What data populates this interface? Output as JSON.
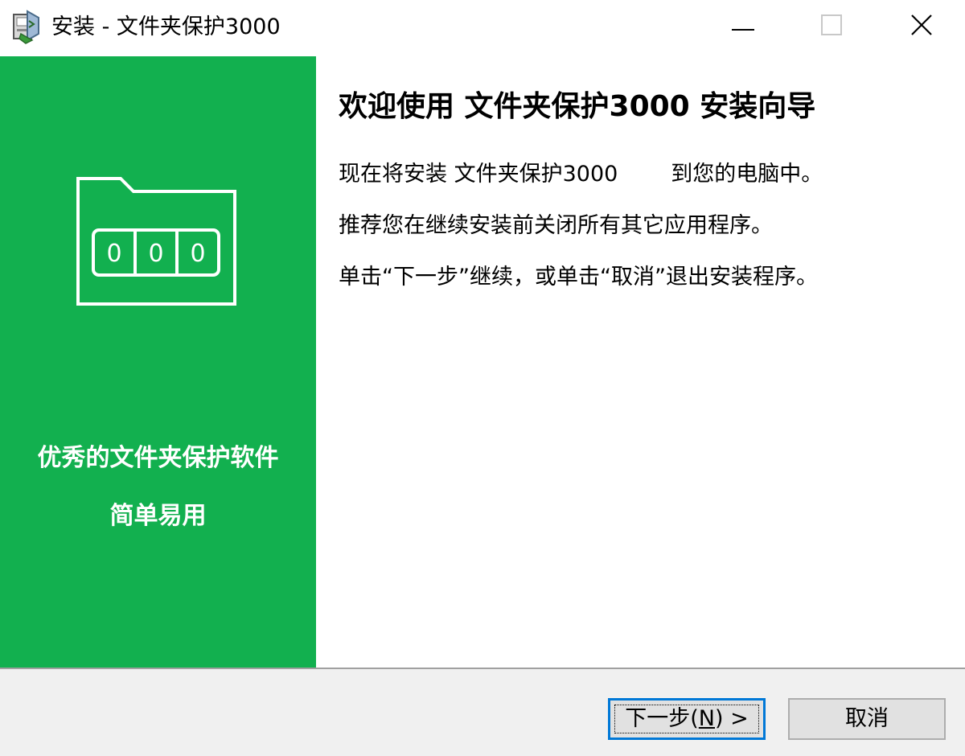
{
  "window": {
    "title": "安装 - 文件夹保护3000",
    "app_icon": "installer-icon",
    "controls": {
      "minimize": "minimize-icon",
      "maximize": "maximize-icon",
      "close": "close-icon"
    }
  },
  "side_panel": {
    "bg_color": "#12b04f",
    "graphic": {
      "icon": "folder-lock-icon",
      "digits": [
        "0",
        "0",
        "0"
      ]
    },
    "line1": "优秀的文件夹保护软件",
    "line2": "简单易用"
  },
  "main": {
    "heading": "欢迎使用 文件夹保护3000 安装向导",
    "para1_a": "现在将安装 文件夹保护3000",
    "para1_b": "到您的电脑中。",
    "para2": "推荐您在继续安装前关闭所有其它应用程序。",
    "para3": "单击“下一步”继续，或单击“取消”退出安装程序。"
  },
  "buttons": {
    "next_pre": "下一步(",
    "next_key": "N",
    "next_post": ") >",
    "cancel": "取消"
  },
  "colors": {
    "accent": "#0078d7",
    "green": "#12b04f"
  }
}
